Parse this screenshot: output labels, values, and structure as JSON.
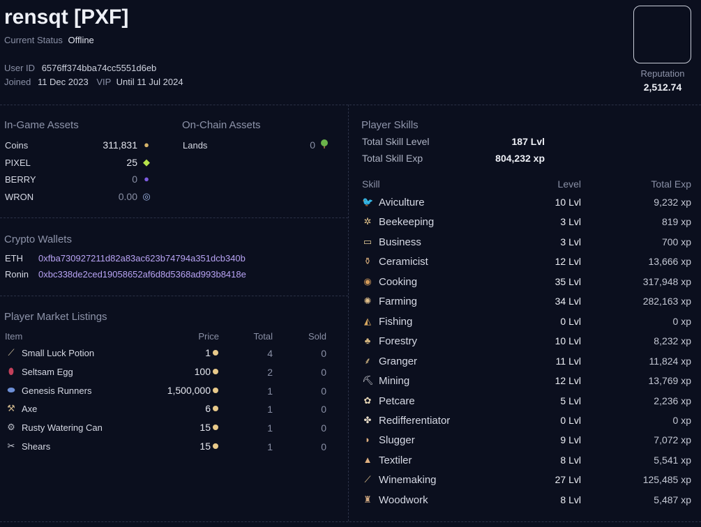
{
  "profile": {
    "name": "rensqt [PXF]",
    "status_label": "Current Status",
    "status_value": "Offline",
    "user_id_label": "User ID",
    "user_id": "6576ff374bba74cc5551d6eb",
    "joined_label": "Joined",
    "joined": "11 Dec 2023",
    "vip_label": "VIP",
    "vip": "Until 11 Jul 2024",
    "reputation_label": "Reputation",
    "reputation": "2,512.74"
  },
  "ingame": {
    "title": "In-Game Assets",
    "items": [
      {
        "name": "Coins",
        "value": "311,831",
        "icon": "coin-icon",
        "color": "#d6b46a"
      },
      {
        "name": "PIXEL",
        "value": "25",
        "icon": "gem-icon",
        "color": "#b6e34a"
      },
      {
        "name": "BERRY",
        "value": "0",
        "icon": "berry-icon",
        "color": "#7d5ce0"
      },
      {
        "name": "WRON",
        "value": "0.00",
        "icon": "ronin-icon",
        "color": "#9fb7e8"
      }
    ]
  },
  "onchain": {
    "title": "On-Chain Assets",
    "items": [
      {
        "name": "Lands",
        "value": "0",
        "icon": "tree-icon"
      }
    ]
  },
  "wallets": {
    "title": "Crypto Wallets",
    "items": [
      {
        "name": "ETH",
        "address": "0xfba730927211d82a83ac623b74794a351dcb340b"
      },
      {
        "name": "Ronin",
        "address": "0xbc338de2ced19058652af6d8d5368ad993b8418e"
      }
    ]
  },
  "market": {
    "title": "Player Market Listings",
    "headers": [
      "Item",
      "Price",
      "Total",
      "Sold"
    ],
    "rows": [
      {
        "item": "Small Luck Potion",
        "price": "1",
        "total": "4",
        "sold": "0",
        "icon": "potion-icon"
      },
      {
        "item": "Seltsam Egg",
        "price": "100",
        "total": "2",
        "sold": "0",
        "icon": "egg-icon"
      },
      {
        "item": "Genesis Runners",
        "price": "1,500,000",
        "total": "1",
        "sold": "0",
        "icon": "shoe-icon"
      },
      {
        "item": "Axe",
        "price": "6",
        "total": "1",
        "sold": "0",
        "icon": "axe-icon"
      },
      {
        "item": "Rusty Watering Can",
        "price": "15",
        "total": "1",
        "sold": "0",
        "icon": "watering-can-icon"
      },
      {
        "item": "Shears",
        "price": "15",
        "total": "1",
        "sold": "0",
        "icon": "shears-icon"
      }
    ]
  },
  "skills": {
    "title": "Player Skills",
    "total_level_label": "Total Skill Level",
    "total_level": "187 Lvl",
    "total_exp_label": "Total Skill Exp",
    "total_exp": "804,232 xp",
    "headers": [
      "Skill",
      "Level",
      "Total Exp"
    ],
    "rows": [
      {
        "name": "Aviculture",
        "level": "10 Lvl",
        "exp": "9,232 xp",
        "icon": "bird-icon"
      },
      {
        "name": "Beekeeping",
        "level": "3 Lvl",
        "exp": "819 xp",
        "icon": "bee-icon"
      },
      {
        "name": "Business",
        "level": "3 Lvl",
        "exp": "700 xp",
        "icon": "briefcase-icon"
      },
      {
        "name": "Ceramicist",
        "level": "12 Lvl",
        "exp": "13,666 xp",
        "icon": "vase-icon"
      },
      {
        "name": "Cooking",
        "level": "35 Lvl",
        "exp": "317,948 xp",
        "icon": "pot-icon"
      },
      {
        "name": "Farming",
        "level": "34 Lvl",
        "exp": "282,163 xp",
        "icon": "crop-icon"
      },
      {
        "name": "Fishing",
        "level": "0 Lvl",
        "exp": "0 xp",
        "icon": "fish-icon"
      },
      {
        "name": "Forestry",
        "level": "10 Lvl",
        "exp": "8,232 xp",
        "icon": "tree-icon"
      },
      {
        "name": "Granger",
        "level": "11 Lvl",
        "exp": "11,824 xp",
        "icon": "wheat-icon"
      },
      {
        "name": "Mining",
        "level": "12 Lvl",
        "exp": "13,769 xp",
        "icon": "pickaxe-icon"
      },
      {
        "name": "Petcare",
        "level": "5 Lvl",
        "exp": "2,236 xp",
        "icon": "paw-icon"
      },
      {
        "name": "Redifferentiator",
        "level": "0 Lvl",
        "exp": "0 xp",
        "icon": "recycle-icon"
      },
      {
        "name": "Slugger",
        "level": "9 Lvl",
        "exp": "7,072 xp",
        "icon": "slug-icon"
      },
      {
        "name": "Textiler",
        "level": "8 Lvl",
        "exp": "5,541 xp",
        "icon": "loom-icon"
      },
      {
        "name": "Winemaking",
        "level": "27 Lvl",
        "exp": "125,485 xp",
        "icon": "bottle-icon"
      },
      {
        "name": "Woodwork",
        "level": "8 Lvl",
        "exp": "5,487 xp",
        "icon": "chair-icon"
      }
    ]
  }
}
